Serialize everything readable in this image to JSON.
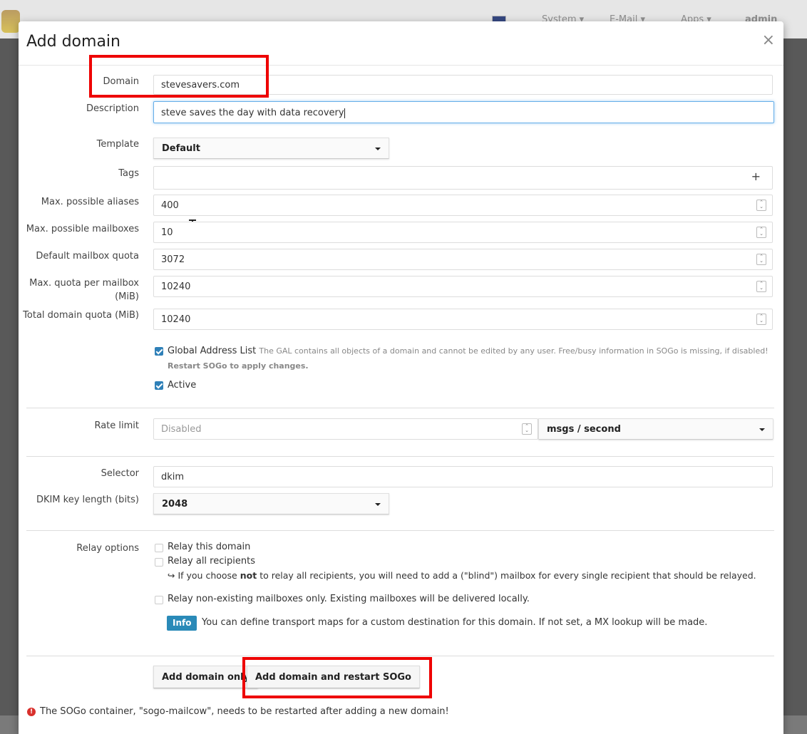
{
  "navbar": {
    "items": [
      "System ▾",
      "E-Mail ▾",
      "Apps ▾",
      "admin"
    ]
  },
  "modal": {
    "title": "Add domain",
    "close_glyph": "×"
  },
  "form": {
    "domain": {
      "label": "Domain",
      "value": "stevesavers.com"
    },
    "description": {
      "label": "Description",
      "value": "steve saves the day with data recovery"
    },
    "template": {
      "label": "Template",
      "selected": "Default"
    },
    "tags": {
      "label": "Tags",
      "add_glyph": "+"
    },
    "max_aliases": {
      "label": "Max. possible aliases",
      "value": "400"
    },
    "max_mailboxes": {
      "label": "Max. possible mailboxes",
      "value": "10"
    },
    "default_quota": {
      "label": "Default mailbox quota",
      "value": "3072"
    },
    "max_quota": {
      "label_line1": "Max. quota per mailbox",
      "label_line2": "(MiB)",
      "value": "10240"
    },
    "total_quota": {
      "label": "Total domain quota (MiB)",
      "value": "10240"
    },
    "gal": {
      "label": "Global Address List",
      "help": "The GAL contains all objects of a domain and cannot be edited by any user. Free/busy information in SOGo is missing, if disabled!",
      "help_bold": "Restart SOGo to apply changes.",
      "checked": true
    },
    "active": {
      "label": "Active",
      "checked": true
    },
    "rate_limit": {
      "label": "Rate limit",
      "placeholder": "Disabled",
      "unit": "msgs / second"
    },
    "selector": {
      "label": "Selector",
      "value": "dkim"
    },
    "dkim_length": {
      "label": "DKIM key length (bits)",
      "selected": "2048"
    },
    "relay": {
      "label": "Relay options",
      "relay_domain": "Relay this domain",
      "relay_all": "Relay all recipients",
      "relay_note_pre": "↪ If you choose",
      "relay_note_bold": "not",
      "relay_note_post": "to relay all recipients, you will need to add a (\"blind\") mailbox for every single recipient that should be relayed.",
      "relay_unknown": "Relay non-existing mailboxes only. Existing mailboxes will be delivered locally."
    },
    "info": {
      "badge": "Info",
      "text": "You can define transport maps for a custom destination for this domain. If not set, a MX lookup will be made."
    }
  },
  "buttons": {
    "add_only": "Add domain only",
    "add_restart": "Add domain and restart SOGo"
  },
  "warning": "The SOGo container, \"sogo-mailcow\", needs to be restarted after adding a new domain!",
  "colors": {
    "accent": "#2f80b8",
    "info_badge": "#2a8ab8",
    "highlight_box": "#ee0000"
  }
}
